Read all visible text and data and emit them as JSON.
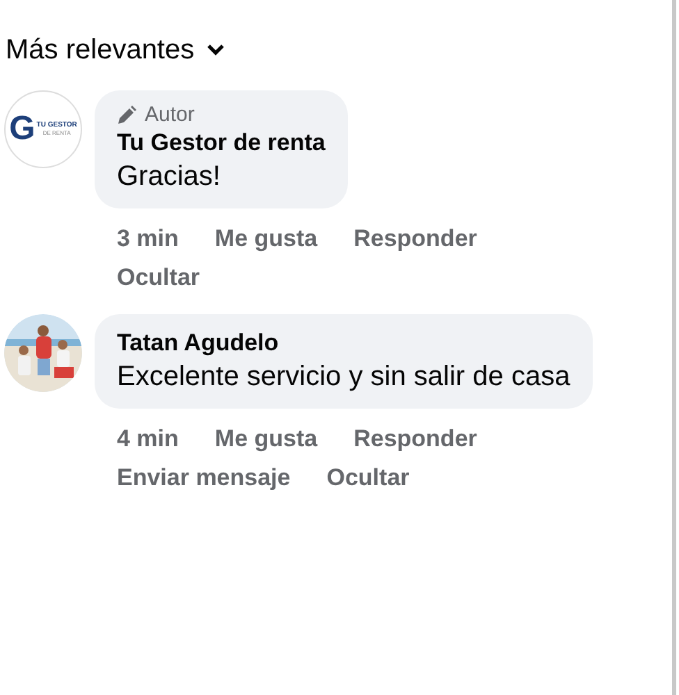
{
  "sort": {
    "label": "Más relevantes"
  },
  "comments": [
    {
      "avatar": {
        "kind": "logo",
        "mark": "G",
        "text": "TU GESTOR",
        "subtext": "DE RENTA"
      },
      "badge": "Autor",
      "author": "Tu Gestor de renta",
      "text": "Gracias!",
      "time": "3 min",
      "actions": [
        "Me gusta",
        "Responder",
        "Ocultar"
      ]
    },
    {
      "author": "Tatan Agudelo",
      "text": "Excelente servicio y sin salir de casa",
      "time": "4 min",
      "actions": [
        "Me gusta",
        "Responder",
        "Enviar mensaje",
        "Ocultar"
      ]
    }
  ]
}
